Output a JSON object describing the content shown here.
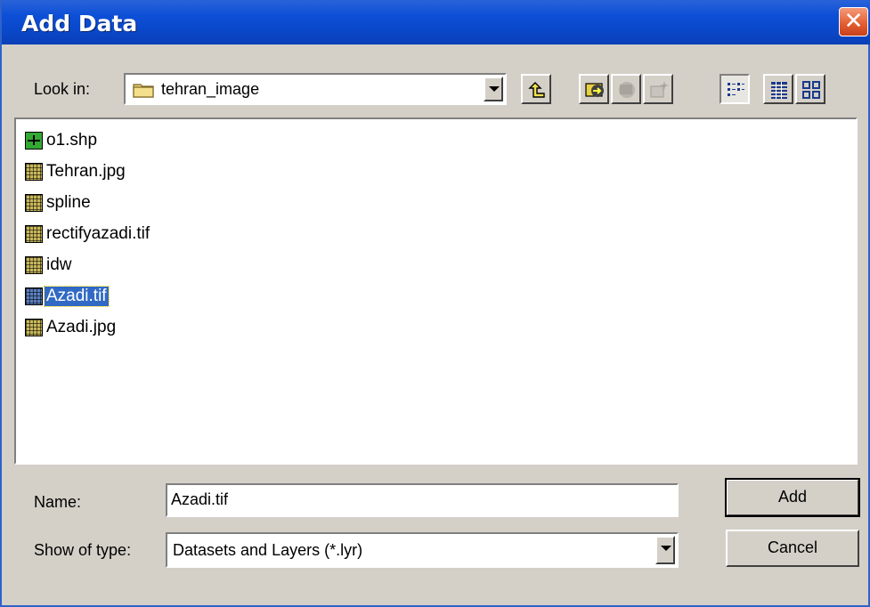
{
  "window": {
    "title": "Add Data",
    "close_glyph": "✕"
  },
  "look_in": {
    "label": "Look in:",
    "value": "tehran_image",
    "icon": "folder-icon"
  },
  "toolbar": {
    "buttons": [
      {
        "name": "up-one-level-icon"
      },
      {
        "name": "connect-to-folder-icon"
      },
      {
        "name": "disconnect-folder-icon"
      },
      {
        "name": "new-item-icon"
      },
      {
        "name": "list-view-icon"
      },
      {
        "name": "details-view-icon"
      },
      {
        "name": "thumbnails-view-icon"
      }
    ]
  },
  "files": [
    {
      "name": "o1.shp",
      "icon": "shapefile-icon"
    },
    {
      "name": "Tehran.jpg",
      "icon": "raster-icon"
    },
    {
      "name": "spline",
      "icon": "raster-icon"
    },
    {
      "name": "rectifyazadi.tif",
      "icon": "raster-icon"
    },
    {
      "name": "idw",
      "icon": "raster-icon"
    },
    {
      "name": "Azadi.tif",
      "icon": "raster-icon",
      "selected": true
    },
    {
      "name": "Azadi.jpg",
      "icon": "raster-icon"
    }
  ],
  "name_field": {
    "label": "Name:",
    "value": "Azadi.tif"
  },
  "type_field": {
    "label": "Show of type:",
    "value": "Datasets and Layers (*.lyr)"
  },
  "buttons": {
    "add": "Add",
    "cancel": "Cancel"
  },
  "colors": {
    "title_bar": "#0a47c9",
    "selection": "#316ac5",
    "dialog_bg": "#d4d0c8"
  }
}
